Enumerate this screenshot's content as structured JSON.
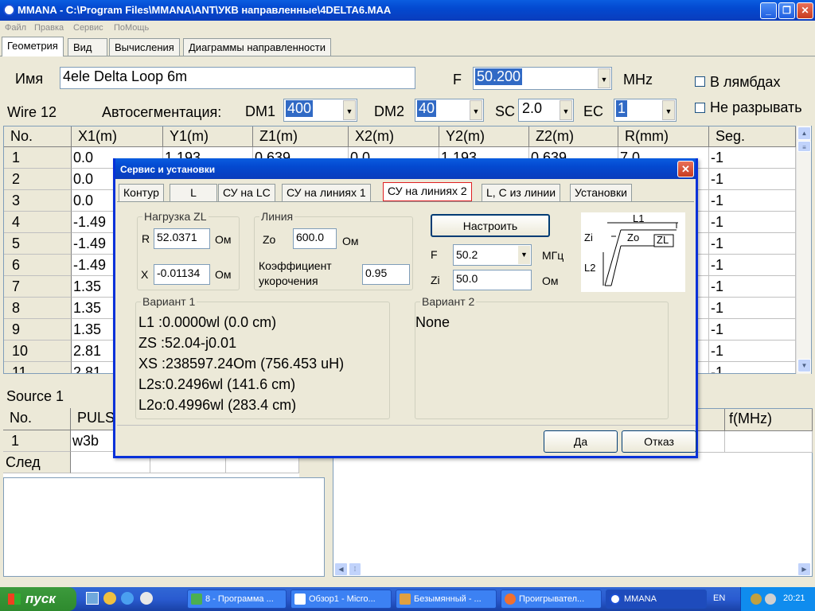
{
  "window": {
    "title": "MMANA - C:\\Program Files\\MMANA\\ANT\\УКВ направленные\\4DELTA6.MAA"
  },
  "menu": [
    "Файл",
    "Правка",
    "Сервис",
    "ПоМощь"
  ],
  "main_tabs": [
    "Геометрия",
    "Вид",
    "Вычисления",
    "Диаграммы направленности"
  ],
  "geometry": {
    "name_label": "Имя",
    "name_value": "4ele Delta Loop 6m",
    "freq_label": "F",
    "freq_value": "50.200",
    "freq_unit": "MHz",
    "lambda_label": "В лямбдах",
    "no_break_label": "Не разрывать",
    "wire_count": "Wire 12",
    "autoseg_label": "Автосегментация:",
    "dm1_label": "DM1",
    "dm1_value": "400",
    "dm2_label": "DM2",
    "dm2_value": "40",
    "sc_label": "SC",
    "sc_value": "2.0",
    "ec_label": "EC",
    "ec_value": "1"
  },
  "wire_table": {
    "headers": [
      "No.",
      "X1(m)",
      "Y1(m)",
      "Z1(m)",
      "X2(m)",
      "Y2(m)",
      "Z2(m)",
      "R(mm)",
      "Seg."
    ],
    "rows": [
      [
        "1",
        "0.0",
        "1.193",
        "0.639",
        "0.0",
        "1.193",
        "0.639",
        "7.0",
        "-1"
      ],
      [
        "2",
        "0.0",
        "",
        "",
        "",
        "",
        "",
        "",
        "-1"
      ],
      [
        "3",
        "0.0",
        "",
        "",
        "",
        "",
        "",
        "",
        "-1"
      ],
      [
        "4",
        "-1.49",
        "",
        "",
        "",
        "",
        "",
        "",
        "-1"
      ],
      [
        "5",
        "-1.49",
        "",
        "",
        "",
        "",
        "",
        "",
        "-1"
      ],
      [
        "6",
        "-1.49",
        "",
        "",
        "",
        "",
        "",
        "",
        "-1"
      ],
      [
        "7",
        "1.35",
        "",
        "",
        "",
        "",
        "",
        "",
        "-1"
      ],
      [
        "8",
        "1.35",
        "",
        "",
        "",
        "",
        "",
        "",
        "-1"
      ],
      [
        "9",
        "1.35",
        "",
        "",
        "",
        "",
        "",
        "",
        "-1"
      ],
      [
        "10",
        "2.81",
        "",
        "",
        "",
        "",
        "",
        "",
        "-1"
      ],
      [
        "11",
        "2.81",
        "",
        "",
        "",
        "",
        "",
        "",
        "-1"
      ]
    ]
  },
  "source": {
    "label": "Source 1",
    "headers": [
      "No.",
      "PULS"
    ],
    "row": [
      "1",
      "w3b"
    ],
    "next": "След",
    "right_header": "f(MHz)"
  },
  "dialog": {
    "title": "Сервис и установки",
    "tabs": [
      "Контур",
      "L",
      "СУ на LC",
      "СУ на линиях 1",
      "СУ на линиях 2",
      "L, C из линии",
      "Установки"
    ],
    "load_group": "Нагрузка ZL",
    "r_label": "R",
    "r_value": "52.0371",
    "r_unit": "Ом",
    "x_label": "X",
    "x_value": "-0.01134",
    "x_unit": "Ом",
    "line_group": "Линия",
    "zo_label": "Zo",
    "zo_value": "600.0",
    "zo_unit": "Ом",
    "vf_label_1": "Коэффициент",
    "vf_label_2": "укорочения",
    "vf_value": "0.95",
    "tune_button": "Настроить",
    "f_label": "F",
    "f_value": "50.2",
    "f_unit": "МГц",
    "zi_label": "Zi",
    "zi_value": "50.0",
    "zi_unit": "Ом",
    "diagram": {
      "l1": "L1",
      "zi": "Zi",
      "zo": "Zo",
      "zl": "ZL",
      "l2": "L2"
    },
    "variant1_title": "Вариант 1",
    "variant1_lines": [
      "L1 :0.0000wl (0.0 cm)",
      "ZS :52.04-j0.01",
      "XS :238597.24Om (756.453 uH)",
      "L2s:0.2496wl (141.6 cm)",
      "L2o:0.4996wl (283.4 cm)"
    ],
    "variant2_title": "Вариант 2",
    "variant2_text": "None",
    "ok_button": "Да",
    "cancel_button": "Отказ"
  },
  "taskbar": {
    "start": "пуск",
    "tasks": [
      "8 - Программа ...",
      "Обзор1 - Micro...",
      "Безымянный - ...",
      "Проигрывател...",
      "MMANA"
    ],
    "lang": "EN",
    "clock": "20:21"
  }
}
